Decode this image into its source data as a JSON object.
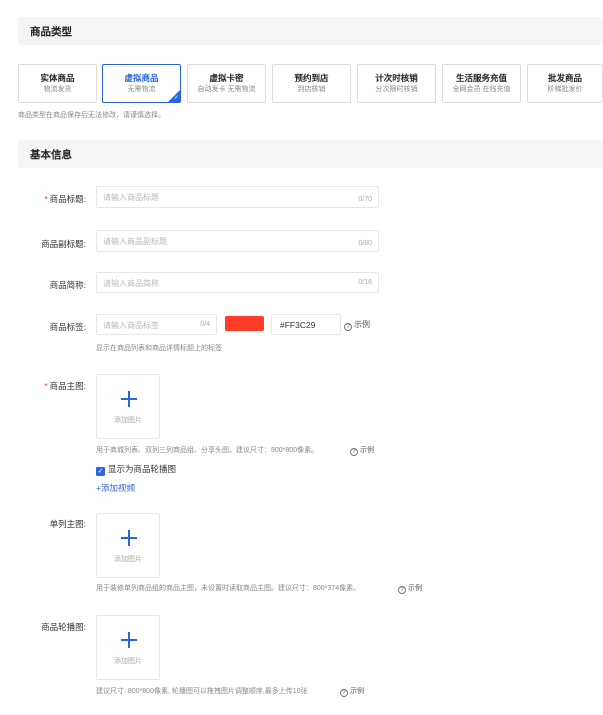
{
  "sections": {
    "product_type": "商品类型",
    "basic_info": "基本信息"
  },
  "product_types": [
    {
      "title": "实体商品",
      "sub": "物流发货"
    },
    {
      "title": "虚拟商品",
      "sub": "无需物流",
      "active": true
    },
    {
      "title": "虚拟卡密",
      "sub": "自动发卡 无需物流"
    },
    {
      "title": "预约到店",
      "sub": "到店核销"
    },
    {
      "title": "计次时核销",
      "sub": "分次限时核销"
    },
    {
      "title": "生活服务充值",
      "sub": "全网会员 在线充值"
    },
    {
      "title": "批发商品",
      "sub": "阶梯批发价"
    }
  ],
  "type_hint": "商品类型在商品保存后无法修改，请谨慎选择。",
  "form": {
    "title": {
      "label": "商品标题:",
      "placeholder": "请输入商品标题",
      "count": "0/70"
    },
    "subtitle": {
      "label": "商品副标题:",
      "placeholder": "请输入商品副标题",
      "count": "0/80"
    },
    "short_name": {
      "label": "商品简称:",
      "placeholder": "请输入商品简称",
      "count": "0/16"
    },
    "tag": {
      "label": "商品标签:",
      "placeholder": "请输入商品标签",
      "count": "0/4",
      "color_value": "#FF3C29",
      "example": "示例",
      "hint": "显示在商品列表和商品详情标题上的标签"
    },
    "main_image": {
      "label": "商品主图:",
      "upload_text": "添加图片",
      "hint": "用于商城列表、双列三列商品组、分享头图。建议尺寸：800*800像素。",
      "example": "示例",
      "checkbox_label": "显示为商品轮播图",
      "add_video": "+添加视频"
    },
    "single_image": {
      "label": "单列主图:",
      "upload_text": "添加图片",
      "hint": "用于装修单列商品组的商品主图，未设置时读取商品主图。建议尺寸：800*374像素。",
      "example": "示例"
    },
    "carousel": {
      "label": "商品轮播图:",
      "upload_text": "添加图片",
      "hint": "建议尺寸: 800*800像素, 轮播图可以拖拽图片调整顺序,最多上传10张",
      "example": "示例"
    }
  },
  "colors": {
    "accent": "#2a65d9",
    "required": "#e5312a",
    "tag_color": "#FF3C29"
  }
}
